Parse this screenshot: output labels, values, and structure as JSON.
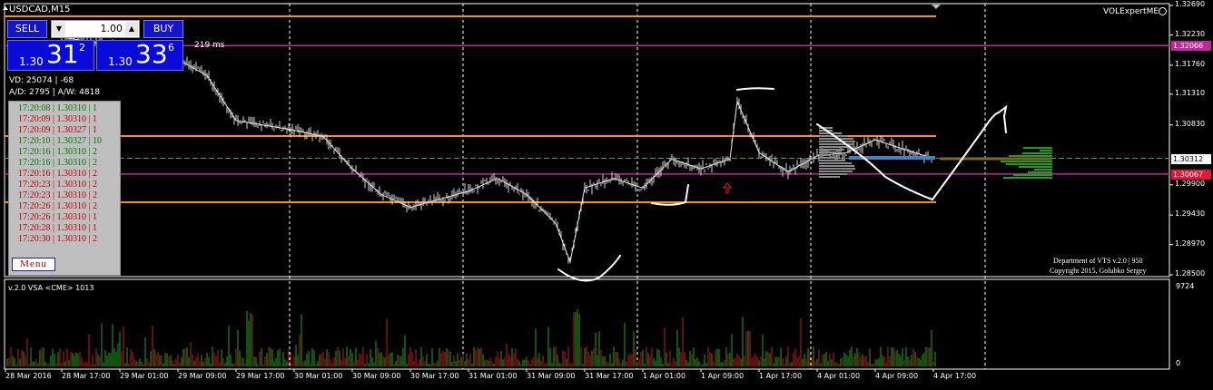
{
  "window": {
    "title": "USDCAD,M15",
    "expert_name": "VOLExpertME"
  },
  "trade_panel": {
    "sell_label": "SELL",
    "buy_label": "BUY",
    "lot_value": "1.00",
    "bid": {
      "prefix": "1.30",
      "big": "31",
      "sup": "2"
    },
    "ask": {
      "prefix": "1.30",
      "big": "33",
      "sup": "6"
    }
  },
  "info": {
    "ping": "219 ms",
    "vd": "VD: 25074 | -68",
    "ad": "A/D: 2795 | A/W: 4818"
  },
  "ticks": [
    {
      "time": "17:20:08",
      "price": "1.30310",
      "volume": "1",
      "dir": "up"
    },
    {
      "time": "17:20:09",
      "price": "1.30310",
      "volume": "1",
      "dir": "dn"
    },
    {
      "time": "17:20:09",
      "price": "1.30327",
      "volume": "1",
      "dir": "dn"
    },
    {
      "time": "17:20:10",
      "price": "1.30327",
      "volume": "10",
      "dir": "up"
    },
    {
      "time": "17:20:16",
      "price": "1.30310",
      "volume": "2",
      "dir": "up"
    },
    {
      "time": "17:20:16",
      "price": "1.30310",
      "volume": "2",
      "dir": "up"
    },
    {
      "time": "17:20:16",
      "price": "1.30310",
      "volume": "2",
      "dir": "dn"
    },
    {
      "time": "17:20:23",
      "price": "1.30310",
      "volume": "2",
      "dir": "dn"
    },
    {
      "time": "17:20:23",
      "price": "1.30310",
      "volume": "2",
      "dir": "dn"
    },
    {
      "time": "17:20:26",
      "price": "1.30310",
      "volume": "2",
      "dir": "dn"
    },
    {
      "time": "17:20:26",
      "price": "1.30310",
      "volume": "1",
      "dir": "dn"
    },
    {
      "time": "17:20:28",
      "price": "1.30310",
      "volume": "1",
      "dir": "dn"
    },
    {
      "time": "17:20:30",
      "price": "1.30310",
      "volume": "2",
      "dir": "dn"
    }
  ],
  "menu_label": "Menu",
  "copyright": {
    "line1": "Department of VTS  v.2.0 | 950",
    "line2": "Copyright 2015, Golubko Sergey"
  },
  "indicator": {
    "label": "v.2.0 VSA <CME> 1013",
    "max_label": "9724",
    "zero_label": "0"
  },
  "colors": {
    "orange_level": "#ff8c1a",
    "magenta_level": "#c0289a",
    "candles": "#d9d9d9",
    "volume_up": "#1fa31f",
    "volume_dn": "#c81e1e",
    "profile_green": "#1e9e1e",
    "current_price_tag": "#2d2d2d"
  },
  "chart_data": {
    "type": "line",
    "symbol": "USDCAD",
    "timeframe": "M15",
    "y_ticks": [
      1.3269,
      1.3223,
      1.3176,
      1.3131,
      1.3083,
      1.299,
      1.2943,
      1.2897,
      1.285
    ],
    "y_tick_labels": [
      "1.32690",
      "1.32230",
      "1.31760",
      "1.31310",
      "1.30830",
      "1.29900",
      "1.29430",
      "1.28970",
      "1.28500"
    ],
    "ylim": [
      1.285,
      1.3269
    ],
    "x_tick_labels": [
      "28 Mar 2016",
      "28 Mar 17:00",
      "29 Mar 01:00",
      "29 Mar 09:00",
      "29 Mar 17:00",
      "30 Mar 01:00",
      "30 Mar 09:00",
      "30 Mar 17:00",
      "31 Mar 01:00",
      "31 Mar 09:00",
      "31 Mar 17:00",
      "1 Apr 01:00",
      "1 Apr 09:00",
      "1 Apr 17:00",
      "4 Apr 01:00",
      "4 Apr 09:00",
      "4 Apr 17:00"
    ],
    "current_price": "1.30312",
    "current_price_value": 1.30312,
    "levels": [
      {
        "label": "1.32066",
        "value": 1.32066,
        "color": "magenta"
      },
      {
        "label": "1.30067",
        "value": 1.30067,
        "color": "magenta"
      }
    ],
    "series": [
      {
        "name": "USDCAD,M15",
        "x": [
          "28 Mar 17:00",
          "29 Mar 01:00",
          "29 Mar 09:00",
          "29 Mar 13:00",
          "29 Mar 17:00",
          "30 Mar 01:00",
          "30 Mar 05:00",
          "30 Mar 09:00",
          "30 Mar 13:00",
          "30 Mar 17:00",
          "31 Mar 01:00",
          "31 Mar 05:00",
          "31 Mar 09:00",
          "31 Mar 13:00",
          "31 Mar 15:00",
          "31 Mar 17:00",
          "31 Mar 21:00",
          "1 Apr 01:00",
          "1 Apr 05:00",
          "1 Apr 09:00",
          "1 Apr 13:00",
          "1 Apr 14:00",
          "1 Apr 17:00",
          "1 Apr 21:00",
          "4 Apr 01:00",
          "4 Apr 05:00",
          "4 Apr 09:00",
          "4 Apr 13:00",
          "4 Apr 17:00"
        ],
        "y": [
          1.322,
          1.3205,
          1.3185,
          1.316,
          1.309,
          1.3075,
          1.3065,
          1.3015,
          1.2975,
          1.2955,
          1.298,
          1.3,
          1.2975,
          1.293,
          1.287,
          1.2985,
          1.3,
          1.2985,
          1.303,
          1.3015,
          1.303,
          1.312,
          1.304,
          1.301,
          1.3035,
          1.304,
          1.306,
          1.3045,
          1.3031
        ]
      }
    ],
    "volume_scale_max": 9724
  }
}
